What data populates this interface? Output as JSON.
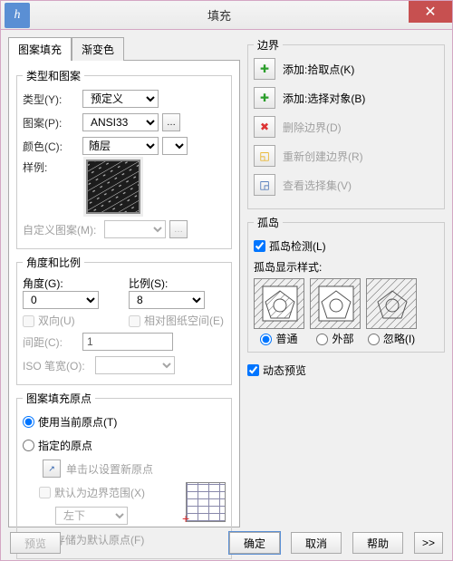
{
  "window": {
    "title": "填充"
  },
  "tabs": {
    "hatch": "图案填充",
    "gradient": "渐变色"
  },
  "groups": {
    "type_pattern": "类型和图案",
    "angle_scale": "角度和比例",
    "origin": "图案填充原点",
    "boundary": "边界",
    "islands": "孤岛"
  },
  "type": {
    "label": "类型(Y):",
    "value": "预定义"
  },
  "pattern": {
    "label": "图案(P):",
    "value": "ANSI33"
  },
  "color": {
    "label": "颜色(C):",
    "value": "随层"
  },
  "sample": {
    "label": "样例:"
  },
  "custom_pattern": {
    "label": "自定义图案(M):"
  },
  "angle": {
    "label": "角度(G):",
    "value": "0"
  },
  "scale": {
    "label": "比例(S):",
    "value": "8"
  },
  "two_way": "双向(U)",
  "relative_paper": "相对图纸空间(E)",
  "spacing": {
    "label": "间距(C):",
    "value": "1"
  },
  "iso_pen": {
    "label": "ISO 笔宽(O):"
  },
  "origin": {
    "use_current": "使用当前原点(T)",
    "specified": "指定的原点",
    "click_set": "单击以设置新原点",
    "default_extent": "默认为边界范围(X)",
    "pos_value": "左下",
    "store": "存储为默认原点(F)"
  },
  "boundary": {
    "add_pick": "添加:拾取点(K)",
    "add_select": "添加:选择对象(B)",
    "remove": "删除边界(D)",
    "recreate": "重新创建边界(R)",
    "view": "查看选择集(V)"
  },
  "islands_section": {
    "detect": "孤岛检测(L)",
    "display_style": "孤岛显示样式:",
    "normal": "普通",
    "outer": "外部",
    "ignore": "忽略(I)"
  },
  "dynamic_preview": "动态预览",
  "footer": {
    "preview": "预览",
    "ok": "确定",
    "cancel": "取消",
    "help": "帮助",
    "expand": ">>"
  }
}
